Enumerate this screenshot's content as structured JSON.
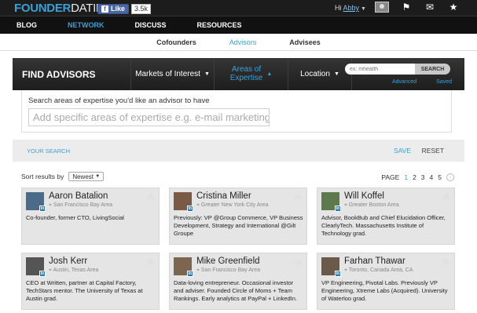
{
  "brand": {
    "logo_bold": "FOUNDER",
    "logo_light": "DATING"
  },
  "facebook": {
    "like_label": "Like",
    "count": "3.5k"
  },
  "user": {
    "greeting": "Hi",
    "name": "Abby"
  },
  "nav": {
    "items": [
      {
        "label": "BLOG"
      },
      {
        "label": "NETWORK"
      },
      {
        "label": "DISCUSS"
      },
      {
        "label": "RESOURCES"
      }
    ]
  },
  "subnav": {
    "items": [
      {
        "label": "Cofounders"
      },
      {
        "label": "Advisors"
      },
      {
        "label": "Advisees"
      }
    ]
  },
  "findbar": {
    "title": "FIND ADVISORS",
    "markets": "Markets of Interest",
    "areas_line1": "Areas of",
    "areas_line2": "Expertise",
    "location": "Location",
    "search_placeholder": "ex: mhealth",
    "search_button": "SEARCH",
    "advanced": "Advanced",
    "saved": "Saved"
  },
  "expertise": {
    "label": "Search areas of expertise you'd like an advisor to have",
    "placeholder": "Add specific areas of expertise e.g. e-mail marketing, UX"
  },
  "yoursearch": {
    "label": "YOUR SEARCH",
    "save": "SAVE",
    "reset": "RESET"
  },
  "sort": {
    "label": "Sort results by",
    "value": "Newest"
  },
  "pager": {
    "label": "PAGE",
    "pages": [
      "1",
      "2",
      "3",
      "4",
      "5"
    ]
  },
  "advisors": [
    {
      "name": "Aaron Batalion",
      "location": "San Francisco Bay Area",
      "bio": "Co-founder, former CTO, LivingSocial",
      "photo_color": "#4a6b8a"
    },
    {
      "name": "Cristina Miller",
      "location": "Greater New York City Area",
      "bio": "Previously: VP @Group Commerce, VP Business Development, Strategy and International @Gilt Groupe",
      "photo_color": "#7a5a44"
    },
    {
      "name": "Will Koffel",
      "location": "Greater Boston Area",
      "bio": "Advisor, BookBub and Chief Elucidation Officer, ClearlyTech. Massachusetts Institute of Technology grad.",
      "photo_color": "#5e7a4c"
    },
    {
      "name": "Josh Kerr",
      "location": "Austin, Texas Area",
      "bio": "CEO at Written, partner at Capital Factory, TechStars mentor. The University of Texas at Austin grad.",
      "photo_color": "#555555"
    },
    {
      "name": "Mike Greenfield",
      "location": "San Francisco Bay Area",
      "bio": "Data-loving entrepreneur. Occasional investor and adviser. Founded Circle of Moms + Team Rankings. Early analytics at PayPal + LinkedIn.",
      "photo_color": "#7c6650"
    },
    {
      "name": "Farhan Thawar",
      "location": "Toronto, Canada Area, CA",
      "bio": "VP Engineering, Pivotal Labs. Previously VP Engineering, Xtreme Labs (Acquired). University of Waterloo grad.",
      "photo_color": "#6b5a4a"
    }
  ]
}
